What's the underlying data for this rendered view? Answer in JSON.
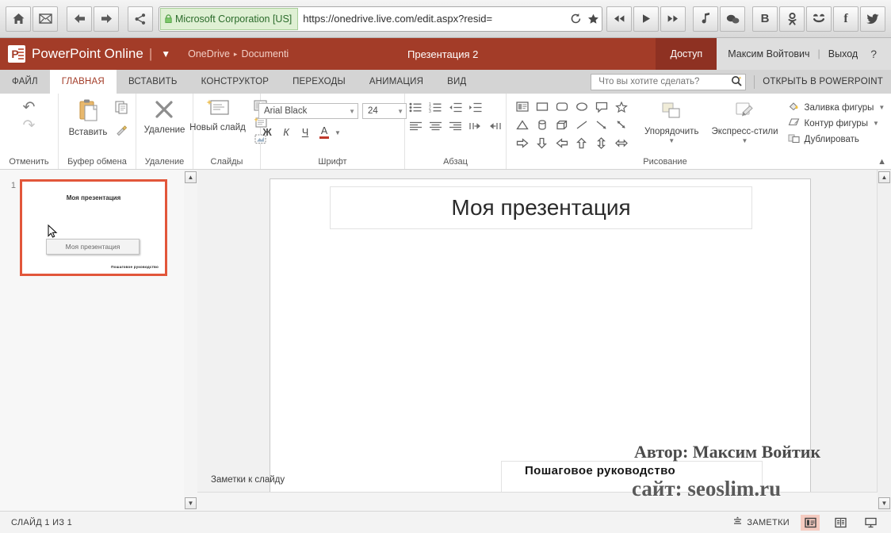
{
  "browser": {
    "nav_buttons": [
      {
        "name": "home-icon",
        "label": "Home"
      },
      {
        "name": "mail-icon",
        "label": "Mail"
      },
      {
        "name": "back-icon",
        "label": "Back"
      },
      {
        "name": "forward-icon",
        "label": "Forward"
      },
      {
        "name": "share-icon",
        "label": "Share"
      }
    ],
    "security_label": "Microsoft Corporation [US]",
    "url": "https://onedrive.live.com/edit.aspx?resid=",
    "reload_icon": "reload-icon",
    "bookmark_icon": "star-icon",
    "media_buttons": [
      {
        "name": "rewind-icon",
        "label": "Rewind"
      },
      {
        "name": "play-icon",
        "label": "Play"
      },
      {
        "name": "fast-forward-icon",
        "label": "Fast forward"
      },
      {
        "name": "music-note-icon",
        "label": "Music"
      },
      {
        "name": "chat-bubbles-icon",
        "label": "Messenger"
      }
    ],
    "social_buttons": [
      {
        "name": "vk-icon",
        "label": "B"
      },
      {
        "name": "odnoklassniki-icon",
        "label": "ok"
      },
      {
        "name": "smiley-icon",
        "label": "Moi Mir"
      },
      {
        "name": "facebook-icon",
        "label": "f"
      },
      {
        "name": "twitter-icon",
        "label": "Twitter"
      }
    ]
  },
  "app_header": {
    "logo_letter": "P",
    "app_title": "PowerPoint Online",
    "divider": "|",
    "breadcrumb": [
      "OneDrive",
      "Documenti"
    ],
    "breadcrumb_separator": "▸",
    "document_name": "Презентация 2",
    "share_label": "Доступ",
    "user_name": "Максим Войтович",
    "sign_out_label": "Выход",
    "help_label": "?"
  },
  "ribbon": {
    "tabs": [
      {
        "label": "ФАЙЛ",
        "active": false
      },
      {
        "label": "ГЛАВНАЯ",
        "active": true
      },
      {
        "label": "ВСТАВИТЬ",
        "active": false
      },
      {
        "label": "КОНСТРУКТОР",
        "active": false
      },
      {
        "label": "ПЕРЕХОДЫ",
        "active": false
      },
      {
        "label": "АНИМАЦИЯ",
        "active": false
      },
      {
        "label": "ВИД",
        "active": false
      }
    ],
    "tell_me_placeholder": "Что вы хотите сделать?",
    "tell_me_value": "",
    "open_in_powerpoint": "ОТКРЫТЬ В POWERPOINT",
    "groups": {
      "undo": {
        "label": "Отменить",
        "undo_icon": "undo-icon",
        "redo_icon": "redo-icon"
      },
      "clipboard": {
        "label": "Буфер обмена",
        "paste_label": "Вставить",
        "copy_icon": "copy-icon",
        "format_painter_icon": "format-painter-icon"
      },
      "delete": {
        "label": "Удаление",
        "delete_label": "Удаление",
        "delete_icon": "delete-x-icon"
      },
      "slides": {
        "label": "Слайды",
        "new_slide_label": "Новый слайд",
        "layout_icon": "slide-layout-icon",
        "section_icon": "slide-section-icon",
        "reset_icon": "slide-reset-icon"
      },
      "font": {
        "label": "Шрифт",
        "font_name": "Arial Black",
        "font_size": "24",
        "bold_label": "Ж",
        "italic_label": "К",
        "underline_label": "Ч",
        "font_color_label": "A"
      },
      "paragraph": {
        "label": "Абзац",
        "buttons": [
          "bullet-list-icon",
          "numbered-list-icon",
          "decrease-indent-icon",
          "increase-indent-icon",
          "align-left-icon",
          "align-center-icon",
          "align-right-icon",
          "ltr-text-icon",
          "rtl-text-icon"
        ]
      },
      "drawing": {
        "label": "Рисование",
        "shapes": [
          "text-box-icon",
          "rectangle-icon",
          "rounded-rectangle-icon",
          "oval-icon",
          "callout-icon",
          "star-shape-icon",
          "triangle-icon",
          "cylinder-icon",
          "cube-icon",
          "line-icon",
          "arrow-line-icon",
          "double-arrow-line-icon",
          "right-arrow-icon",
          "down-arrow-icon",
          "left-arrow-icon",
          "up-arrow-icon",
          "up-down-arrow-icon",
          "left-right-arrow-icon"
        ],
        "arrange_label": "Упорядочить",
        "quick_styles_label": "Экспресс-стили",
        "shape_fill_label": "Заливка фигуры",
        "shape_outline_label": "Контур фигуры",
        "duplicate_label": "Дублировать",
        "collapse_icon": "chevron-up-icon"
      }
    }
  },
  "thumbnails": {
    "slides": [
      {
        "number": "1",
        "title": "Моя презентация",
        "subtitle": "Пошаговое руководство",
        "tooltip": "Моя презентация",
        "selected": true
      }
    ]
  },
  "slide": {
    "title_text": "Моя презентация",
    "subtitle_text": ""
  },
  "notes": {
    "label": "Заметки к слайду",
    "value": ""
  },
  "status_bar": {
    "slide_counter": "СЛАЙД 1 ИЗ 1",
    "notes_label": "ЗАМЕТКИ",
    "notes_icon": "notes-icon",
    "views": [
      {
        "name": "normal-view-button",
        "icon": "normal-view-icon",
        "active": true
      },
      {
        "name": "reading-view-button",
        "icon": "reading-view-icon",
        "active": false
      },
      {
        "name": "slideshow-view-button",
        "icon": "slideshow-icon",
        "active": false
      }
    ]
  },
  "watermark": {
    "author": "Автор: Максим Войтик",
    "subtitle": "Пошаговое руководство",
    "site": "сайт: seoslim.ru"
  },
  "colors": {
    "accent": "#a33c28",
    "share_bg": "#8e3122",
    "selection": "#e2563a",
    "secure_green": "#2b6b2b"
  }
}
